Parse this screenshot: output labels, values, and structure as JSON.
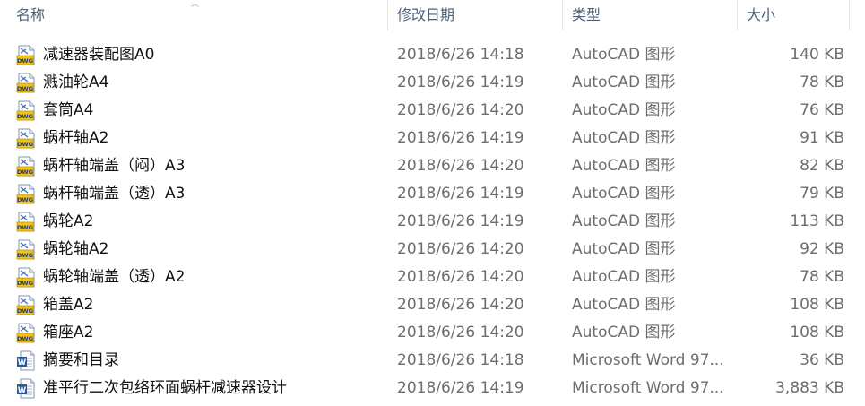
{
  "columns": {
    "name": "名称",
    "date": "修改日期",
    "type": "类型",
    "size": "大小"
  },
  "files": [
    {
      "name": "减速器装配图A0",
      "date": "2018/6/26 14:18",
      "type": "AutoCAD 图形",
      "size": "140 KB",
      "icon": "dwg-file-icon"
    },
    {
      "name": "溅油轮A4",
      "date": "2018/6/26 14:19",
      "type": "AutoCAD 图形",
      "size": "78 KB",
      "icon": "dwg-file-icon"
    },
    {
      "name": "套筒A4",
      "date": "2018/6/26 14:20",
      "type": "AutoCAD 图形",
      "size": "76 KB",
      "icon": "dwg-file-icon"
    },
    {
      "name": "蜗杆轴A2",
      "date": "2018/6/26 14:19",
      "type": "AutoCAD 图形",
      "size": "91 KB",
      "icon": "dwg-file-icon"
    },
    {
      "name": "蜗杆轴端盖（闷）A3",
      "date": "2018/6/26 14:20",
      "type": "AutoCAD 图形",
      "size": "82 KB",
      "icon": "dwg-file-icon"
    },
    {
      "name": "蜗杆轴端盖（透）A3",
      "date": "2018/6/26 14:19",
      "type": "AutoCAD 图形",
      "size": "79 KB",
      "icon": "dwg-file-icon"
    },
    {
      "name": "蜗轮A2",
      "date": "2018/6/26 14:19",
      "type": "AutoCAD 图形",
      "size": "113 KB",
      "icon": "dwg-file-icon"
    },
    {
      "name": "蜗轮轴A2",
      "date": "2018/6/26 14:20",
      "type": "AutoCAD 图形",
      "size": "92 KB",
      "icon": "dwg-file-icon"
    },
    {
      "name": "蜗轮轴端盖（透）A2",
      "date": "2018/6/26 14:20",
      "type": "AutoCAD 图形",
      "size": "78 KB",
      "icon": "dwg-file-icon"
    },
    {
      "name": "箱盖A2",
      "date": "2018/6/26 14:20",
      "type": "AutoCAD 图形",
      "size": "108 KB",
      "icon": "dwg-file-icon"
    },
    {
      "name": "箱座A2",
      "date": "2018/6/26 14:20",
      "type": "AutoCAD 图形",
      "size": "108 KB",
      "icon": "dwg-file-icon"
    },
    {
      "name": "摘要和目录",
      "date": "2018/6/26 14:18",
      "type": "Microsoft Word 97...",
      "size": "36 KB",
      "icon": "word-doc-icon"
    },
    {
      "name": "准平行二次包络环面蜗杆减速器设计",
      "date": "2018/6/26 14:19",
      "type": "Microsoft Word 97...",
      "size": "3,883 KB",
      "icon": "word-doc-icon"
    }
  ],
  "colors": {
    "header_text": "#4c607a",
    "secondary_text": "#6d6d6d",
    "dwg_badge": "#f2c21a",
    "dwg_badge_text": "#1c3f7a",
    "word_blue": "#2b579a"
  }
}
